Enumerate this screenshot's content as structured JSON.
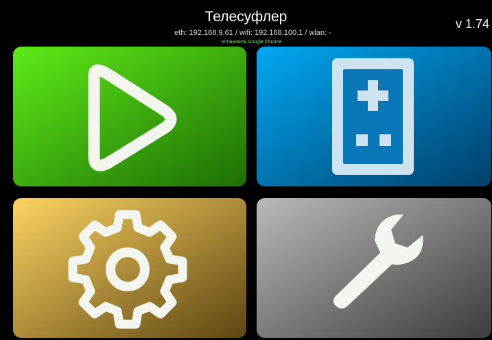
{
  "header": {
    "title": "Телесуфлер",
    "network_status": "eth: 192.168.9.61 / wifi: 192.168.100.1 / wlan: -",
    "install_link": "Установить Google Chrome",
    "version": "v 1.74"
  },
  "tiles": [
    {
      "icon": "play-icon",
      "colors": [
        "#5dea17",
        "#1e6e05"
      ]
    },
    {
      "icon": "remote-control-icon",
      "colors": [
        "#00a8f2",
        "#003f6a"
      ]
    },
    {
      "icon": "gear-icon",
      "colors": [
        "#fbd460",
        "#5e4512"
      ]
    },
    {
      "icon": "wrench-icon",
      "colors": [
        "#b9b9b9",
        "#3c3c3c"
      ]
    }
  ],
  "colors": {
    "background": "#000000",
    "icon": "#f3f6ef",
    "link": "#5cff1c"
  }
}
